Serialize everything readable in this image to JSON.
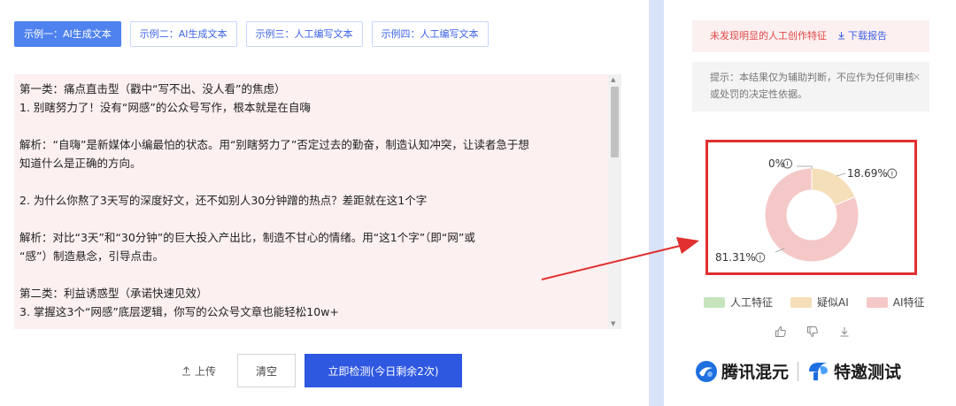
{
  "tabs": [
    {
      "label": "示例一：AI生成文本",
      "active": true
    },
    {
      "label": "示例二：AI生成文本",
      "active": false
    },
    {
      "label": "示例三：人工编写文本",
      "active": false
    },
    {
      "label": "示例四：人工编写文本",
      "active": false
    }
  ],
  "content": {
    "lines": [
      "第一类：痛点直击型（戳中“写不出、没人看”的焦虑）",
      "1. 别瞎努力了！没有“网感”的公众号写作，根本就是在自嗨",
      "",
      "解析：“自嗨”是新媒体小编最怕的状态。用“别瞎努力了”否定过去的勤奋，制造认知冲突，让读者急于想",
      "知道什么是正确的方向。",
      "",
      "2. 为什么你熬了3天写的深度好文，还不如别人30分钟蹭的热点？差距就在这1个字",
      "",
      "解析：对比“3天”和“30分钟”的巨大投入产出比，制造不甘心的情绪。用“这1个字”（即“网”或",
      "“感”）制造悬念，引导点击。",
      "",
      "第二类：利益诱惑型（承诺快速见效）",
      "3. 掌握这3个“网感”底层逻辑，你写的公众号文章也能轻松10w+"
    ]
  },
  "actions": {
    "upload_label": "上传",
    "clear_label": "清空",
    "detect_label": "立即检测(今日剩余2次)"
  },
  "result": {
    "warning": "未发现明显的人工创作特征",
    "download_label": "下载报告",
    "hint": "提示：本结果仅为辅助判断，不应作为任何审核或处罚的决定性依据。"
  },
  "chart_data": {
    "type": "pie",
    "donut": true,
    "categories": [
      "人工特征",
      "疑似AI",
      "AI特征"
    ],
    "values": [
      0,
      18.69,
      81.31
    ],
    "labels": [
      "0%",
      "18.69%",
      "81.31%"
    ],
    "colors": [
      "#c6e5bc",
      "#f5dfb8",
      "#f5c8c8"
    ]
  },
  "brand": {
    "name1": "腾讯混元",
    "name2": "特邀测试"
  },
  "colors": {
    "accent": "#2f58e0",
    "annotation_red": "#e03030"
  }
}
